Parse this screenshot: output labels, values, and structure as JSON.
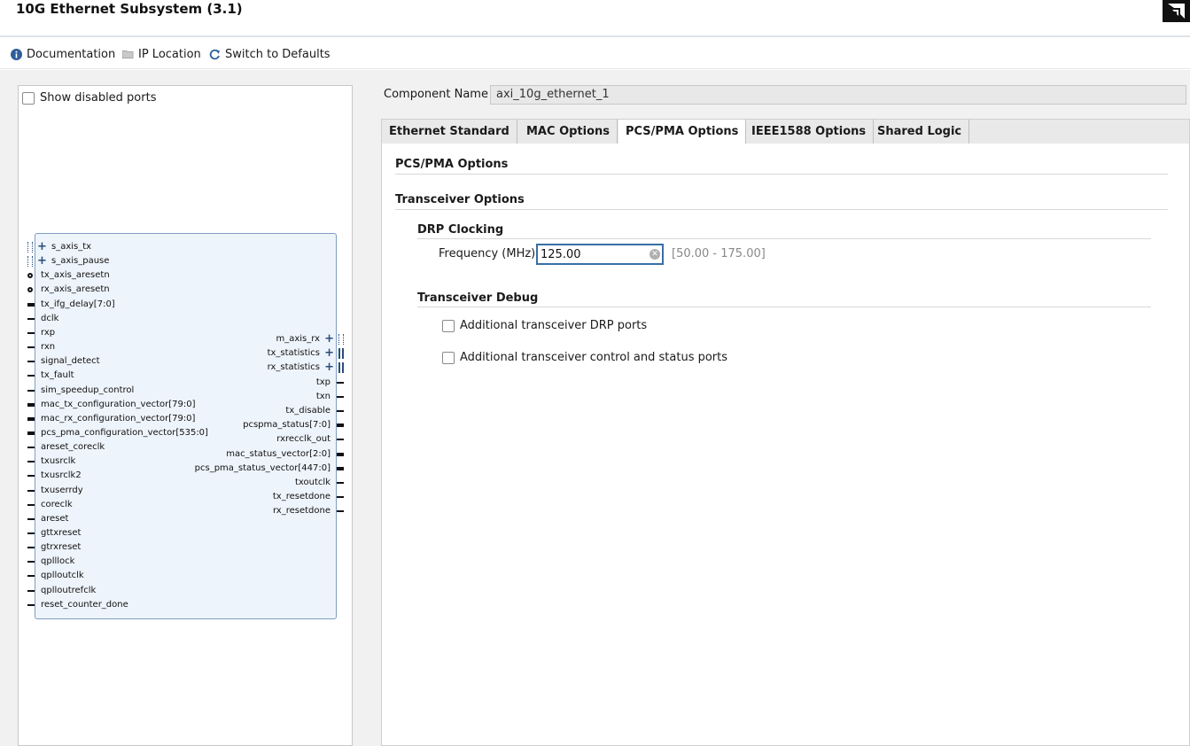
{
  "window": {
    "title": "10G Ethernet Subsystem (3.1)"
  },
  "toolbar": {
    "documentation": "Documentation",
    "ip_location": "IP Location",
    "switch_defaults": "Switch to Defaults"
  },
  "diagram": {
    "show_disabled_ports": "Show disabled ports",
    "left_ports": [
      "s_axis_tx",
      "s_axis_pause",
      "tx_axis_aresetn",
      "rx_axis_aresetn",
      "tx_ifg_delay[7:0]",
      "dclk",
      "rxp",
      "rxn",
      "signal_detect",
      "tx_fault",
      "sim_speedup_control",
      "mac_tx_configuration_vector[79:0]",
      "mac_rx_configuration_vector[79:0]",
      "pcs_pma_configuration_vector[535:0]",
      "areset_coreclk",
      "txusrclk",
      "txusrclk2",
      "txuserrdy",
      "coreclk",
      "areset",
      "gttxreset",
      "gtrxreset",
      "qplllock",
      "qplloutclk",
      "qplloutrefclk",
      "reset_counter_done"
    ],
    "right_ports": [
      "m_axis_rx",
      "tx_statistics",
      "rx_statistics",
      "txp",
      "txn",
      "tx_disable",
      "pcspma_status[7:0]",
      "rxrecclk_out",
      "mac_status_vector[2:0]",
      "pcs_pma_status_vector[447:0]",
      "txoutclk",
      "tx_resetdone",
      "rx_resetdone"
    ]
  },
  "config": {
    "component_name_label": "Component Name",
    "component_name_value": "axi_10g_ethernet_1",
    "tabs": [
      "Ethernet Standard",
      "MAC Options",
      "PCS/PMA Options",
      "IEEE1588 Options",
      "Shared Logic"
    ],
    "active_tab": "PCS/PMA Options",
    "pcs_pma_title": "PCS/PMA Options",
    "transceiver_title": "Transceiver Options",
    "drp_title": "DRP Clocking",
    "frequency_label": "Frequency (MHz)",
    "frequency_value": "125.00",
    "frequency_range": "[50.00 - 175.00]",
    "debug_title": "Transceiver Debug",
    "debug_option_1": "Additional transceiver DRP ports",
    "debug_option_2": "Additional transceiver control and status ports"
  },
  "colors": {
    "block_fill": "#eef4fb",
    "block_border": "#7f9ec4",
    "accent": "#3a6ea5"
  }
}
